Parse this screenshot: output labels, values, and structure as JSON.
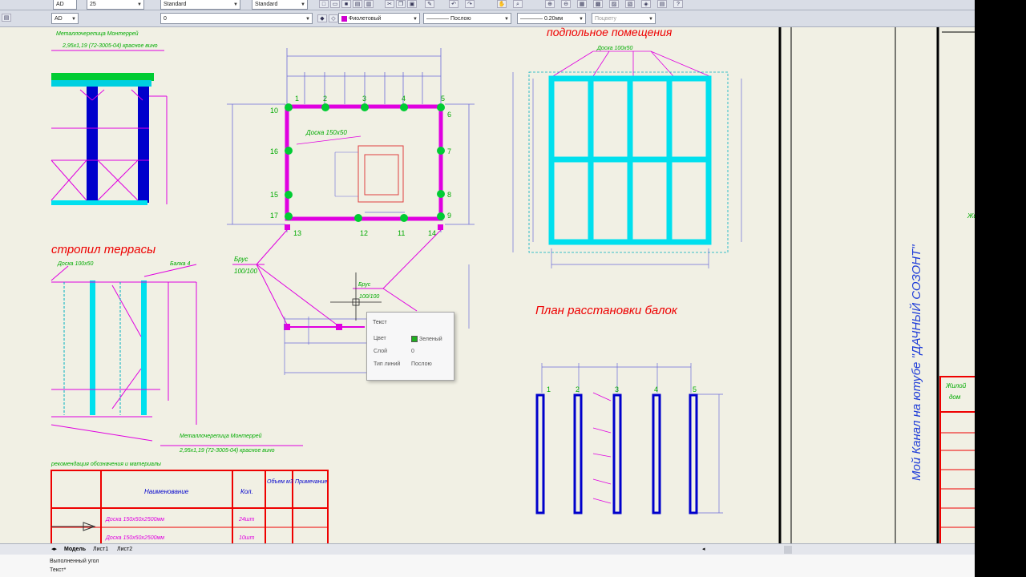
{
  "toolbar": {
    "style_combo_1": "Standard",
    "style_combo_2": "Standard",
    "layer_combo": "0",
    "scale_combo": "25",
    "left_combo": "AD",
    "color_combo": "Фиолетовый",
    "linetype_combo": "Послою",
    "lineweight_combo": "0.20мм",
    "plotstyle_combo": "Поцвету"
  },
  "colors": {
    "canvas": "#f1f0e4",
    "magenta": "#e000e0",
    "cyan": "#00e0ee",
    "blue": "#0000cc",
    "green": "#00cc33",
    "red": "#e00000"
  },
  "drawing": {
    "label_stropila": "стропил террасы",
    "label_doska_100": "Доска 100х50",
    "label_balka4": "Балка 4",
    "label_doska_150": "Доска 150х50",
    "label_bruset_a": "Брус",
    "label_bruset_b": "100/100",
    "label_brus_c": "Брус",
    "label_brus_d": "100/100",
    "label_doska_top": "Доска 100х50",
    "heading_podpol": "подпольное помещения",
    "heading_plan": "План расстановки балок",
    "label_metal_1": "Металлочерепица Монтеррей",
    "label_metal_1b": "2,95х1,19 (72-3005-04) красное вино",
    "label_metal_2": "Металлочерепица Монтеррей",
    "label_metal_2b": "2,95х1,19 (72-3005-04) красное вино",
    "label_spec": "рекомендация обозначения и материалы",
    "vertical_title": "Мой Канал на ютубе \"ДАЧНЫЙ СОЗОНТ\"",
    "side_label_1": "Жилой",
    "side_label_2": "дом",
    "nodes": [
      "1",
      "2",
      "3",
      "4",
      "5",
      "6",
      "7",
      "8",
      "9",
      "10",
      "11",
      "12",
      "13",
      "14",
      "15",
      "16",
      "17"
    ],
    "beams": [
      "1",
      "2",
      "3",
      "4",
      "5"
    ]
  },
  "table": {
    "headers": [
      "Наименование",
      "Кол.",
      "Объем м3",
      "Примечание"
    ],
    "rows": [
      [
        "Доска 150х50х2500мм",
        "24шт"
      ],
      [
        "Доска 150х50х2500мм",
        "10шт"
      ]
    ]
  },
  "tooltip": {
    "title": "Текст",
    "rows": [
      {
        "label": "Цвет",
        "value": "Зеленый"
      },
      {
        "label": "Слой",
        "value": "0"
      },
      {
        "label": "Тип линий",
        "value": "Послою"
      }
    ]
  },
  "tabs": {
    "model": "Модель",
    "sheet1": "Лист1",
    "sheet2": "Лист2"
  },
  "command": {
    "line1": "Выполненный угол",
    "line2": "Текст*"
  }
}
